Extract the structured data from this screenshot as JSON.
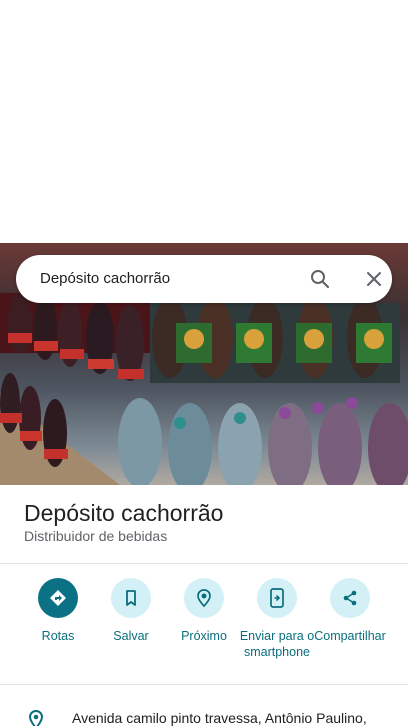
{
  "search": {
    "query": "Depósito cachorrão"
  },
  "place": {
    "name": "Depósito cachorrão",
    "category": "Distribuidor de bebidas"
  },
  "actions": [
    {
      "label": "Rotas",
      "icon": "directions-icon"
    },
    {
      "label": "Salvar",
      "icon": "bookmark-icon"
    },
    {
      "label": "Próximo",
      "icon": "nearby-icon"
    },
    {
      "label": "Enviar para o smartphone",
      "icon": "send-to-phone-icon"
    },
    {
      "label": "Compartilhar",
      "icon": "share-icon"
    }
  ],
  "address": {
    "text": "Avenida camilo pinto travessa, Antônio Paulino,"
  },
  "colors": {
    "accent": "#0b7285",
    "accent_light": "#d4f0f7",
    "action_text": "#0b6e7d"
  }
}
